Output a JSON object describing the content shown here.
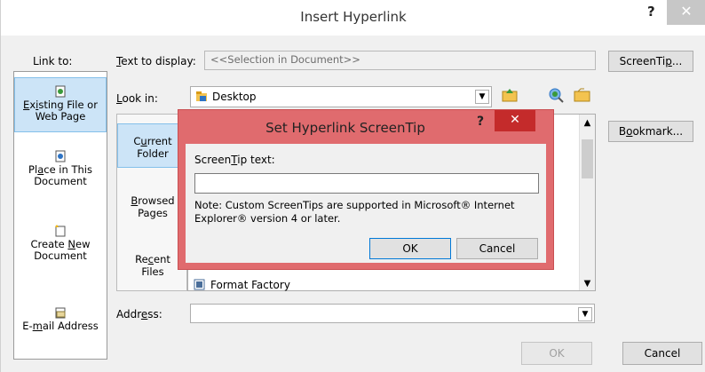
{
  "window": {
    "title": "Insert Hyperlink",
    "help": "?",
    "close": "✕"
  },
  "link_to": {
    "label": "Link to:",
    "items": [
      {
        "line1": "Existing File or",
        "line2": "Web Page",
        "icon": "existing-file-icon"
      },
      {
        "line1": "Place in This",
        "line2": "Document",
        "icon": "place-in-document-icon"
      },
      {
        "line1": "Create New",
        "line2": "Document",
        "icon": "new-document-icon"
      },
      {
        "line1": "E-mail Address",
        "line2": "",
        "icon": "email-icon"
      }
    ]
  },
  "text_to_display": {
    "label": "Text to display:",
    "value": "<<Selection in Document>>"
  },
  "buttons": {
    "screentip": "ScreenTip...",
    "bookmark": "Bookmark...",
    "ok": "OK",
    "cancel": "Cancel"
  },
  "look_in": {
    "label": "Look in:",
    "value": "Desktop"
  },
  "nav": {
    "current": {
      "line1": "Current",
      "line2": "Folder"
    },
    "browsed": {
      "line1": "Browsed",
      "line2": "Pages"
    },
    "recent": {
      "line1": "Recent",
      "line2": "Files"
    }
  },
  "files": [
    {
      "name": "Format Factory"
    }
  ],
  "address": {
    "label": "Address:",
    "value": ""
  },
  "screentip_dialog": {
    "title": "Set Hyperlink ScreenTip",
    "help": "?",
    "close": "✕",
    "field_label": "ScreenTip text:",
    "field_value": "",
    "note_line1": "Note: Custom ScreenTips are supported in Microsoft® Internet",
    "note_line2": "Explorer® version 4 or later.",
    "ok": "OK",
    "cancel": "Cancel"
  }
}
